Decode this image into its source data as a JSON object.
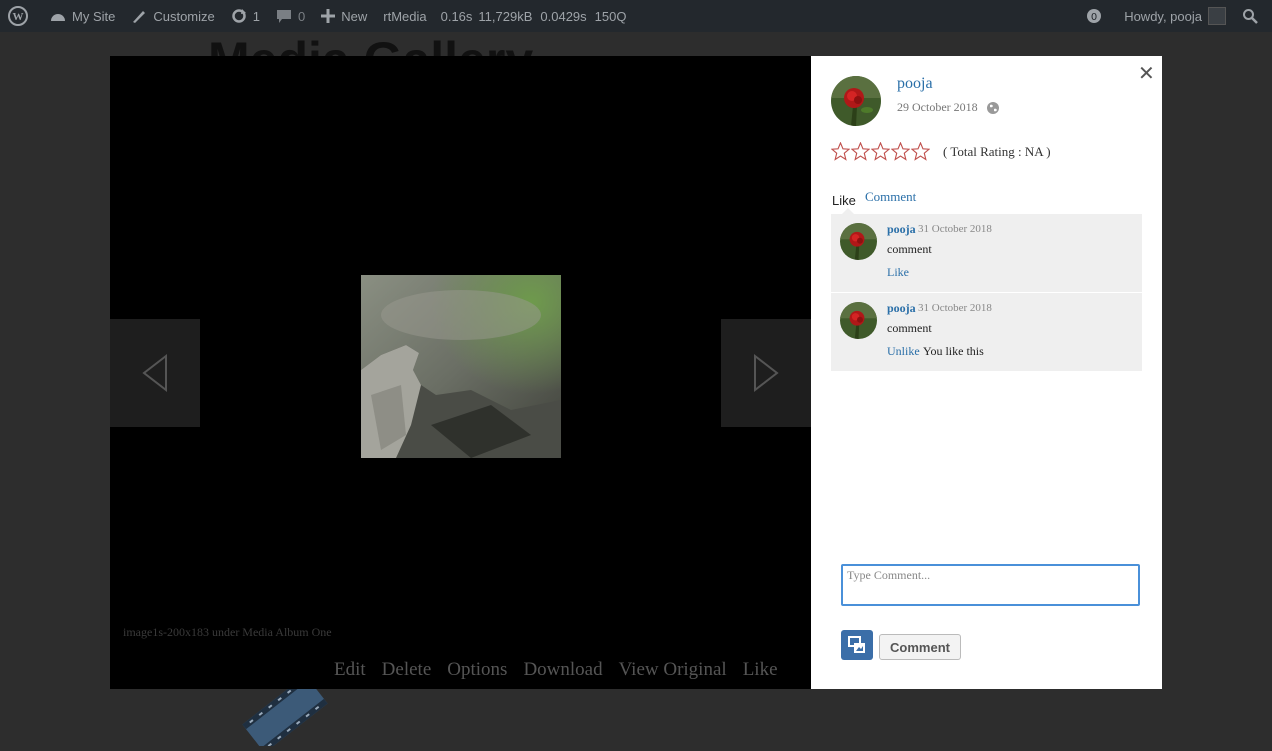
{
  "admin_bar": {
    "my_site": "My Site",
    "customize": "Customize",
    "updates_count": "1",
    "comments_count": "0",
    "new_label": "New",
    "rtmedia": "rtMedia",
    "debug_time": "0.16s",
    "debug_memory": "11,729kB",
    "debug_query_time": "0.0429s",
    "debug_queries": "150Q",
    "howdy": "Howdy, pooja"
  },
  "background": {
    "page_title": "Media Gallery"
  },
  "media": {
    "caption": "image1s-200x183 under Media Album One",
    "actions": [
      "Edit",
      "Delete",
      "Options",
      "Download",
      "View Original",
      "Like"
    ]
  },
  "sidebar": {
    "author": "pooja",
    "date": "29 October 2018",
    "rating_stars": 0,
    "rating_max": 5,
    "total_rating": "( Total Rating : NA )",
    "tab_like": "Like",
    "tab_comment": "Comment",
    "comments": [
      {
        "author": "pooja",
        "date": "31 October 2018",
        "text": "comment",
        "like_label": "Like",
        "status": ""
      },
      {
        "author": "pooja",
        "date": "31 October 2018",
        "text": "comment",
        "like_label": "Unlike",
        "status": "You like this"
      }
    ],
    "comment_placeholder": "Type Comment...",
    "submit_label": "Comment"
  },
  "colors": {
    "link": "#2a6fa8",
    "star": "#c0504d",
    "admin_bar": "#23282d",
    "accent_button": "#3b6ea8"
  }
}
